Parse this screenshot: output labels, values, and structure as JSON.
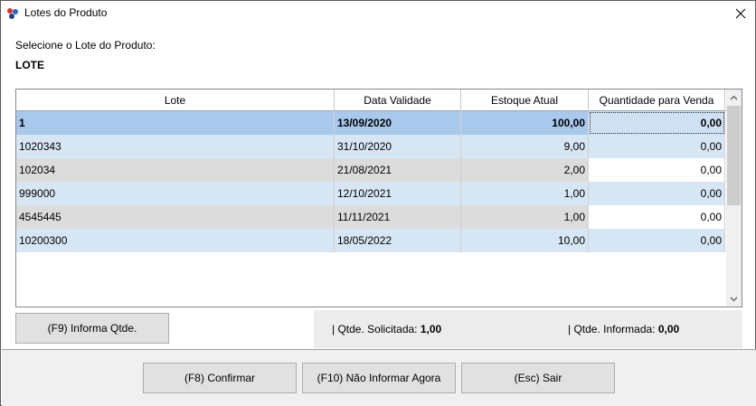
{
  "window": {
    "title": "Lotes do Produto",
    "close_glyph": "✕"
  },
  "labels": {
    "select_prompt": "Selecione o Lote do Produto:",
    "lote": "LOTE"
  },
  "grid": {
    "columns": [
      "Lote",
      "Data Validade",
      "Estoque Atual",
      "Quantidade para Venda"
    ],
    "rows": [
      {
        "lote": "1",
        "validade": "13/09/2020",
        "estoque": "100,00",
        "qtd": "0,00",
        "selected": true
      },
      {
        "lote": "1020343",
        "validade": "31/10/2020",
        "estoque": "9,00",
        "qtd": "0,00"
      },
      {
        "lote": "102034",
        "validade": "21/08/2021",
        "estoque": "2,00",
        "qtd": "0,00"
      },
      {
        "lote": "999000",
        "validade": "12/10/2021",
        "estoque": "1,00",
        "qtd": "0,00"
      },
      {
        "lote": "4545445",
        "validade": "11/11/2021",
        "estoque": "1,00",
        "qtd": "0,00"
      },
      {
        "lote": "10200300",
        "validade": "18/05/2022",
        "estoque": "10,00",
        "qtd": "0,00"
      }
    ]
  },
  "buttons": {
    "f9": "(F9) Informa Qtde.",
    "f8": "(F8) Confirmar",
    "f10": "(F10) Não Informar Agora",
    "esc": "(Esc) Sair"
  },
  "info": {
    "solicitada_label": "| Qtde. Solicitada:",
    "solicitada_value": "1,00",
    "informada_label": "| Qtde. Informada:",
    "informada_value": "0,00"
  },
  "colors": {
    "selected_row": "#a9c9ec",
    "alt_row_blue": "#d7e6f4",
    "alt_row_gray": "#dcdcdc"
  }
}
